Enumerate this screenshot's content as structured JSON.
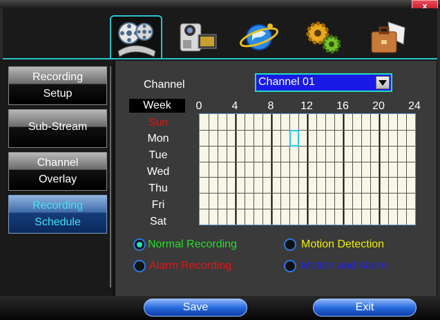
{
  "window": {
    "close_label": "x"
  },
  "toolbar": {
    "tabs": [
      {
        "name": "record-tab",
        "icon": "film-reel-icon",
        "active": true
      },
      {
        "name": "camera-tab",
        "icon": "camcorder-icon",
        "active": false
      },
      {
        "name": "network-tab",
        "icon": "network-globe-icon",
        "active": false
      },
      {
        "name": "settings-tab",
        "icon": "gears-icon",
        "active": false
      },
      {
        "name": "tools-tab",
        "icon": "briefcase-icon",
        "active": false
      }
    ]
  },
  "sidebar": {
    "items": [
      {
        "line1": "Recording",
        "line2": "Setup",
        "active": false
      },
      {
        "line1": "Sub-Stream",
        "line2": "",
        "active": false
      },
      {
        "line1": "Channel",
        "line2": "Overlay",
        "active": false
      },
      {
        "line1": "Recording",
        "line2": "Schedule",
        "active": true
      }
    ]
  },
  "main": {
    "channel_label": "Channel",
    "channel_value": "Channel 01",
    "week_label": "Week",
    "hours": [
      "0",
      "4",
      "8",
      "12",
      "16",
      "20",
      "24"
    ],
    "days": [
      "Sun",
      "Mon",
      "Tue",
      "Wed",
      "Thu",
      "Fri",
      "Sat"
    ],
    "selected_cell": {
      "day": "Mon",
      "hour": 10
    },
    "legend": [
      {
        "label": "Normal Recording",
        "color": "#22e022",
        "checked": true
      },
      {
        "label": "Motion Detection",
        "color": "#f0f000",
        "checked": false
      },
      {
        "label": "Alarm Recording",
        "color": "#e01818",
        "checked": false
      },
      {
        "label": "Motion and Alarm",
        "color": "#2020e8",
        "checked": false
      }
    ]
  },
  "footer": {
    "save_label": "Save",
    "exit_label": "Exit"
  },
  "colors": {
    "accent": "#2cc2ce",
    "active_day": "#e01818",
    "grid_bg": "#f8f6e6",
    "selected_cell": "#22c8e8"
  }
}
